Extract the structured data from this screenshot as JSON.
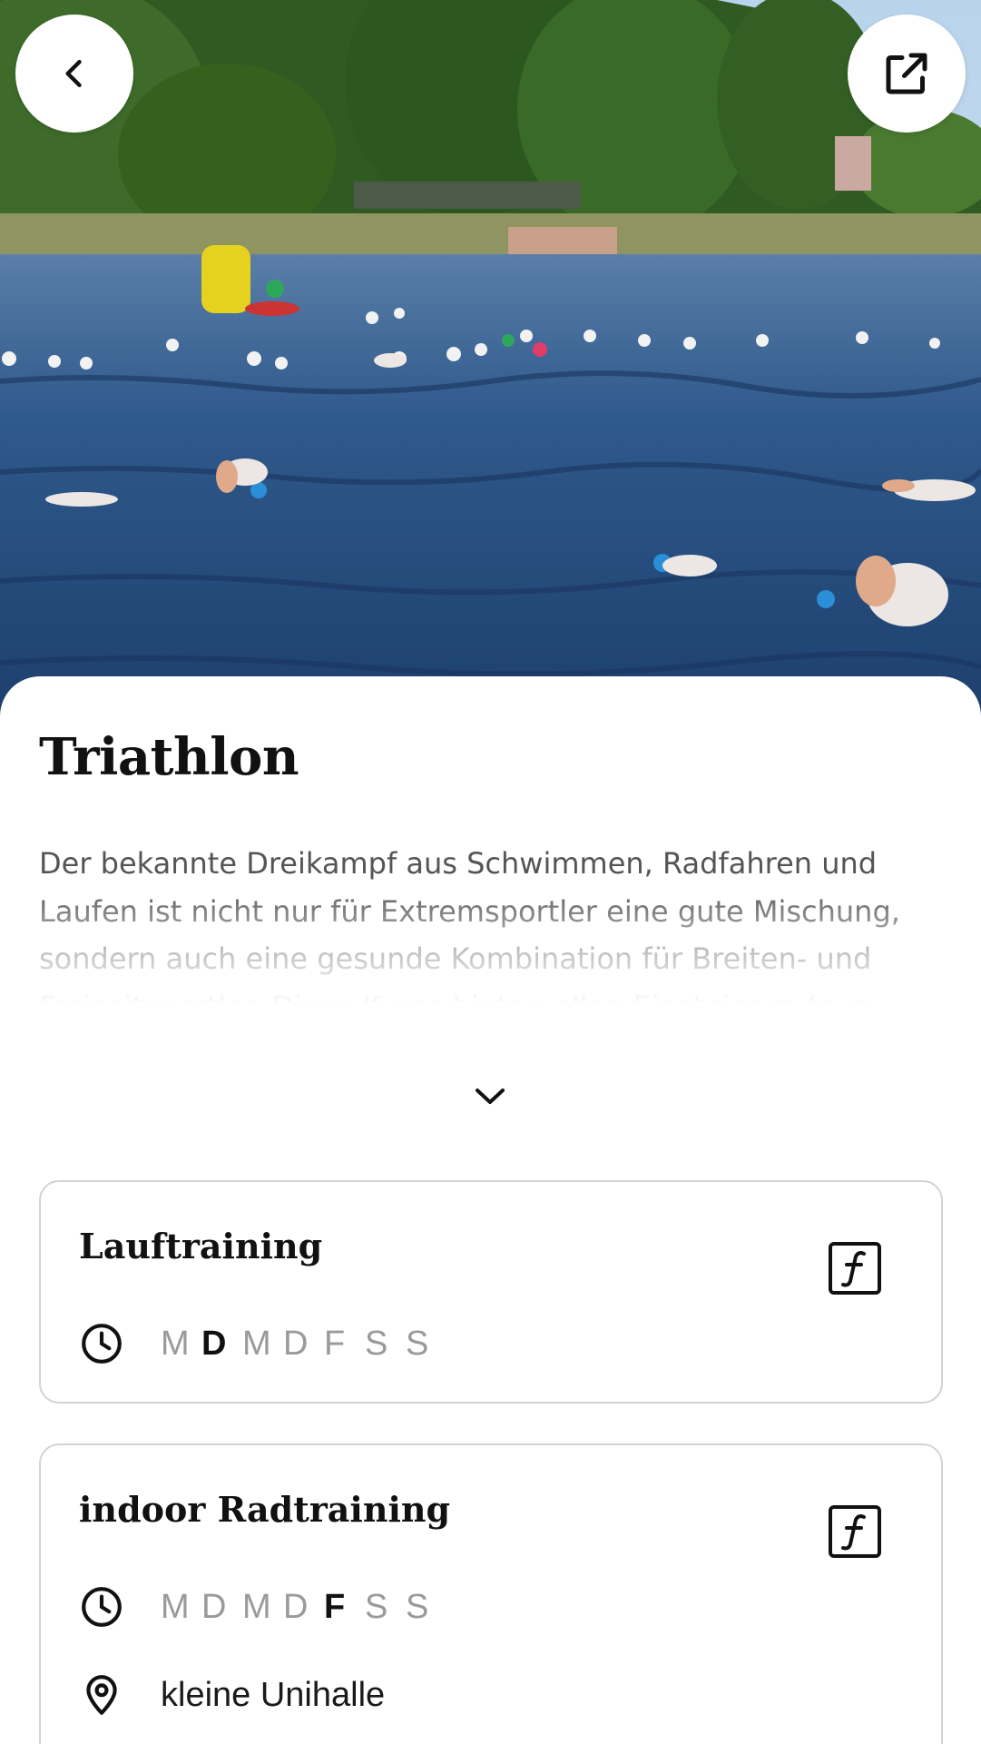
{
  "header": {
    "back_icon": "chevron-left-icon",
    "share_icon": "open-external-icon",
    "hero_image": "open-water swimmers in a lake"
  },
  "sport": {
    "title": "Triathlon",
    "description": "Der bekannte Dreikampf aus Schwimmen, Radfahren und Laufen ist nicht nur für Extremsportler eine gute Mischung, sondern auch eine gesunde Kombination für Breiten- und Freizeitsportler. Diese Kurse bieten allen Einsteigern (nur Laufen), aber",
    "expand_icon": "chevron-down-icon"
  },
  "courses": [
    {
      "name": "Lauftraining",
      "icon": "function-icon",
      "days": [
        {
          "label": "M",
          "active": false
        },
        {
          "label": "D",
          "active": true
        },
        {
          "label": "M",
          "active": false
        },
        {
          "label": "D",
          "active": false
        },
        {
          "label": "F",
          "active": false
        },
        {
          "label": "S",
          "active": false
        },
        {
          "label": "S",
          "active": false
        }
      ]
    },
    {
      "name": "indoor Radtraining",
      "icon": "function-icon",
      "days": [
        {
          "label": "M",
          "active": false
        },
        {
          "label": "D",
          "active": false
        },
        {
          "label": "M",
          "active": false
        },
        {
          "label": "D",
          "active": false
        },
        {
          "label": "F",
          "active": true
        },
        {
          "label": "S",
          "active": false
        },
        {
          "label": "S",
          "active": false
        }
      ],
      "location": "kleine Unihalle"
    }
  ]
}
